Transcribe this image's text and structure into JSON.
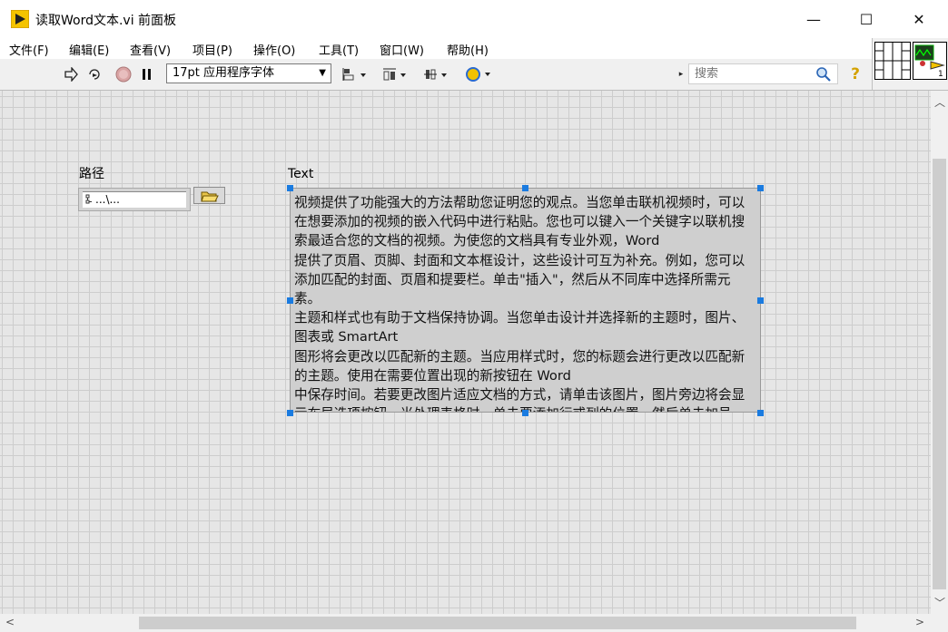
{
  "window": {
    "title": "读取Word文本.vi 前面板",
    "minimize": "—",
    "maximize": "☐",
    "close": "✕"
  },
  "menu": [
    "文件(F)",
    "编辑(E)",
    "查看(V)",
    "项目(P)",
    "操作(O)",
    "工具(T)",
    "窗口(W)",
    "帮助(H)"
  ],
  "toolbar": {
    "font": "17pt 应用程序字体",
    "search_placeholder": "搜索",
    "help_glyph": "?"
  },
  "connector": {
    "terminal_count": "1"
  },
  "controls": {
    "path_label": "路径",
    "path_value": "...\\...",
    "text_label": "Text",
    "text_value": "视频提供了功能强大的方法帮助您证明您的观点。当您单击联机视频时，可以在想要添加的视频的嵌入代码中进行粘贴。您也可以键入一个关键字以联机搜索最适合您的文档的视频。为使您的文档具有专业外观，Word\n提供了页眉、页脚、封面和文本框设计，这些设计可互为补充。例如，您可以添加匹配的封面、页眉和提要栏。单击\"插入\"，然后从不同库中选择所需元素。\n主题和样式也有助于文档保持协调。当您单击设计并选择新的主题时，图片、图表或 SmartArt\n图形将会更改以匹配新的主题。当应用样式时，您的标题会进行更改以匹配新的主题。使用在需要位置出现的新按钮在 Word\n中保存时间。若要更改图片适应文档的方式，请单击该图片，图片旁边将会显示布局选项按钮。当处理表格时，单击要添加行或列的位置，然后单击加号。"
  },
  "colors": {
    "selection_handle": "#1a7be0",
    "canvas": "#e6e6e6",
    "grid": "#cdcdcd"
  }
}
